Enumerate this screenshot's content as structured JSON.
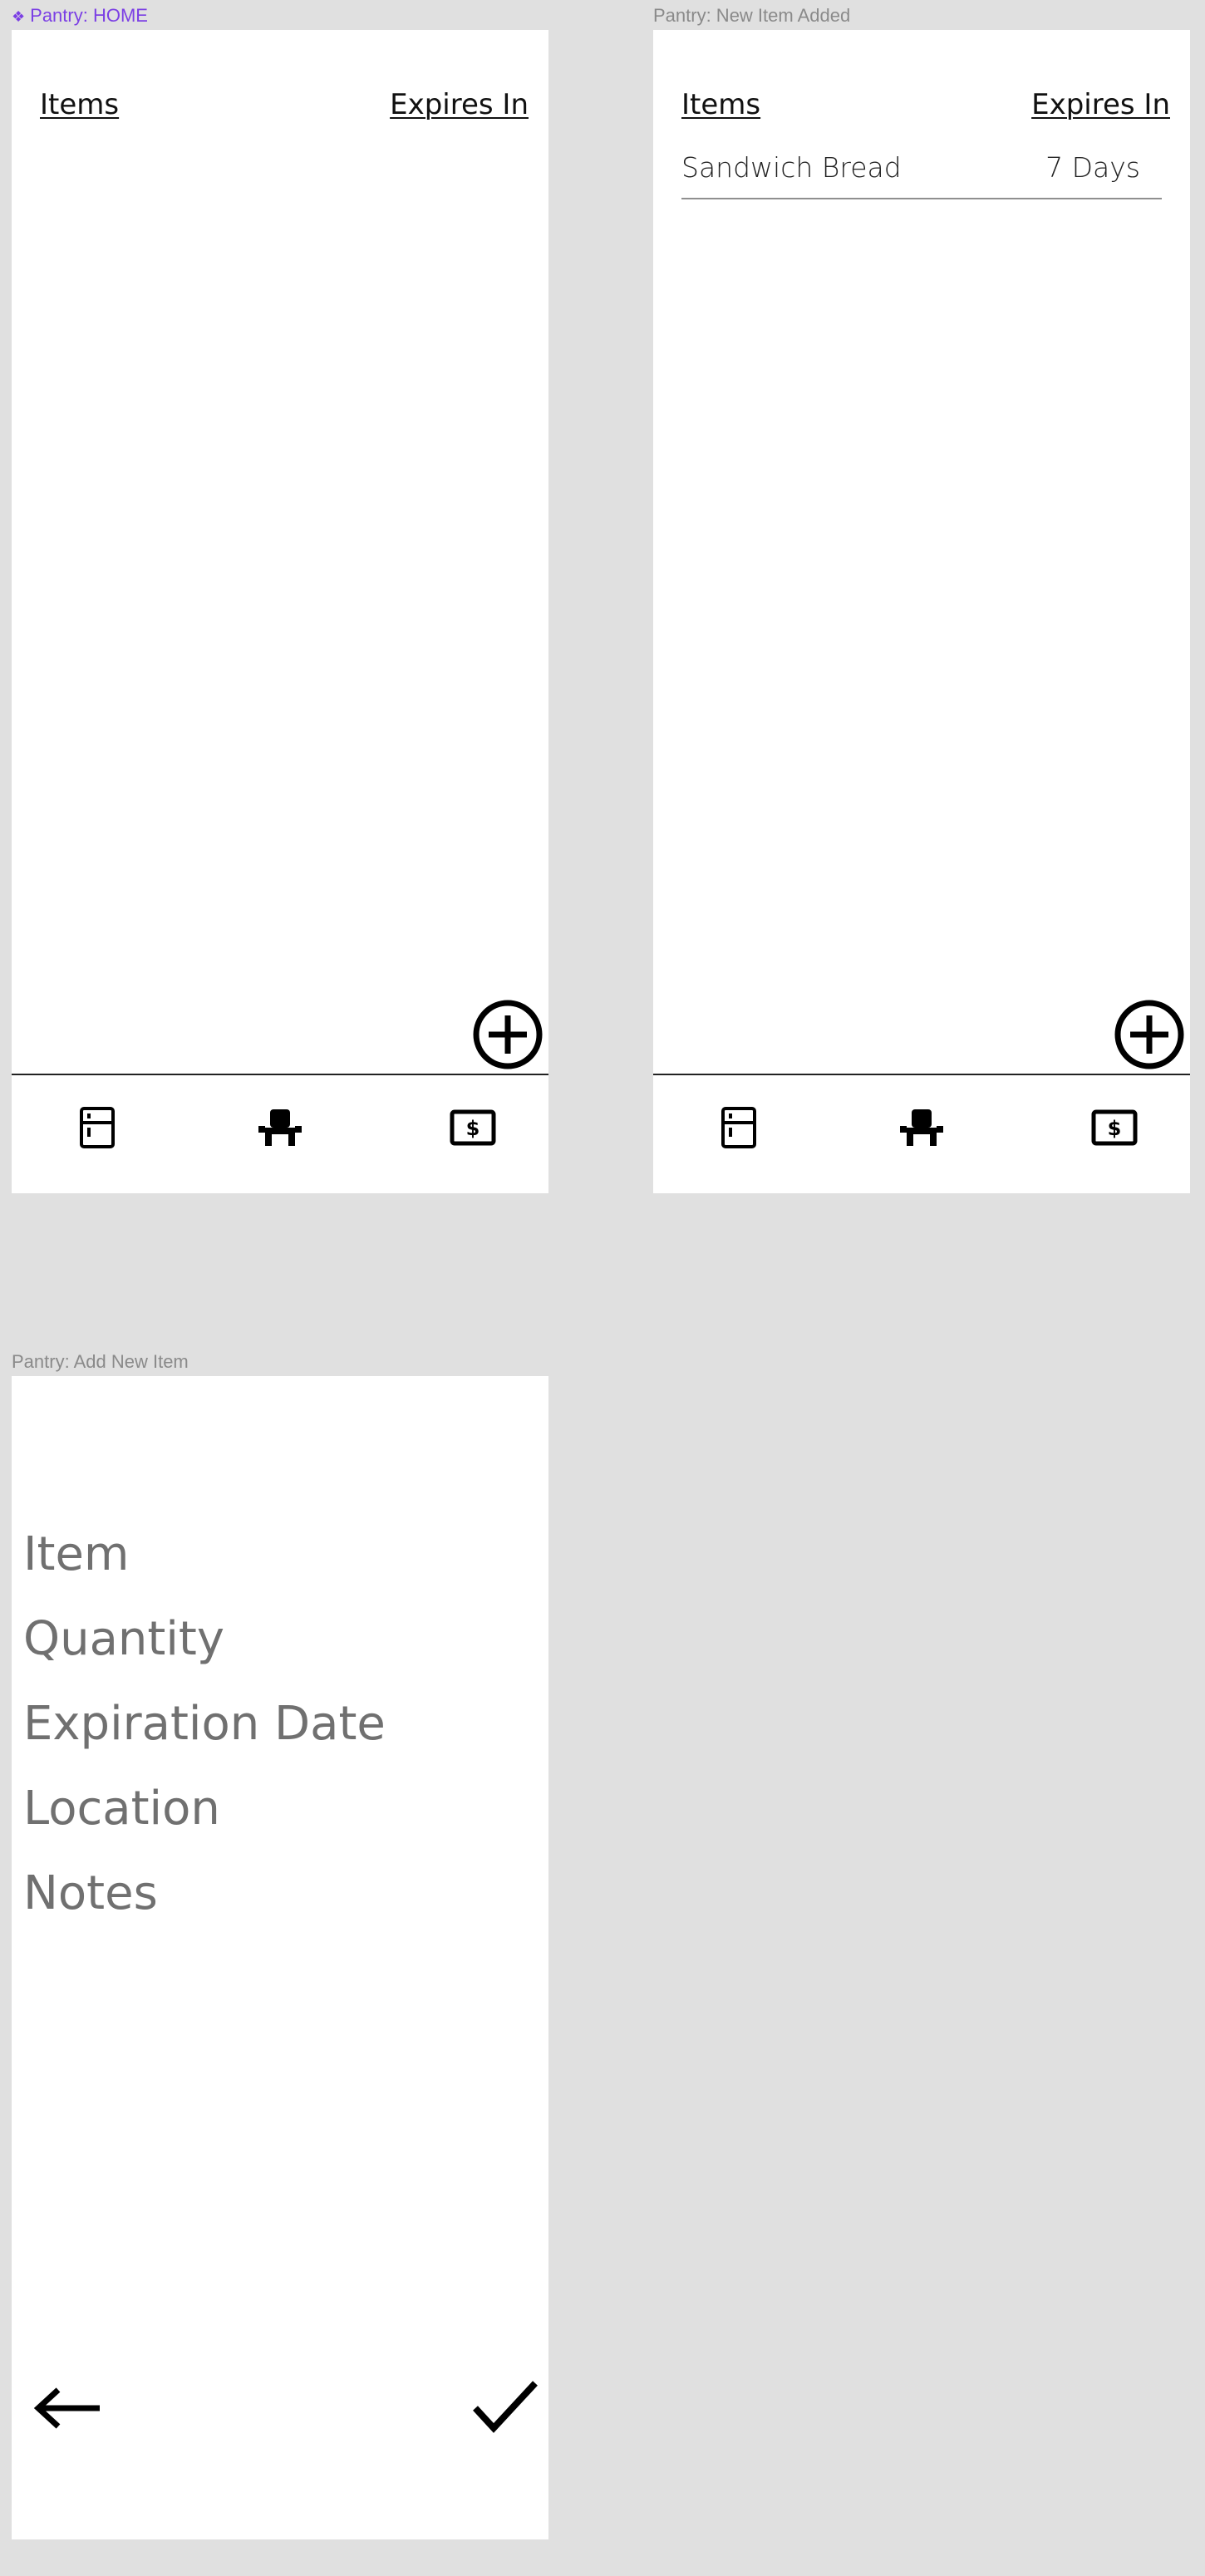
{
  "frames": {
    "home": {
      "label": "Pantry: HOME",
      "label_icon": "component-diamond-icon",
      "header": {
        "items": "Items",
        "expires": "Expires In"
      },
      "fab_icon": "add-circle-icon",
      "nav": [
        "fridge-icon",
        "armchair-icon",
        "dollar-bill-icon"
      ]
    },
    "new_item_added": {
      "label": "Pantry: New Item Added",
      "header": {
        "items": "Items",
        "expires": "Expires In"
      },
      "rows": [
        {
          "name": "Sandwich Bread",
          "expires": "7 Days"
        }
      ],
      "fab_icon": "add-circle-icon",
      "nav": [
        "fridge-icon",
        "armchair-icon",
        "dollar-bill-icon"
      ]
    },
    "add_new_item": {
      "label": "Pantry: Add New Item",
      "fields": [
        "Item",
        "Quantity",
        "Expiration Date",
        "Location",
        "Notes"
      ],
      "back_icon": "arrow-left-icon",
      "confirm_icon": "checkmark-icon"
    }
  },
  "colors": {
    "canvas": "#e0e0e0",
    "frame": "#ffffff",
    "home_label": "#7b3fe4",
    "frame_label": "#8a8a8a",
    "field_text": "#707070"
  }
}
